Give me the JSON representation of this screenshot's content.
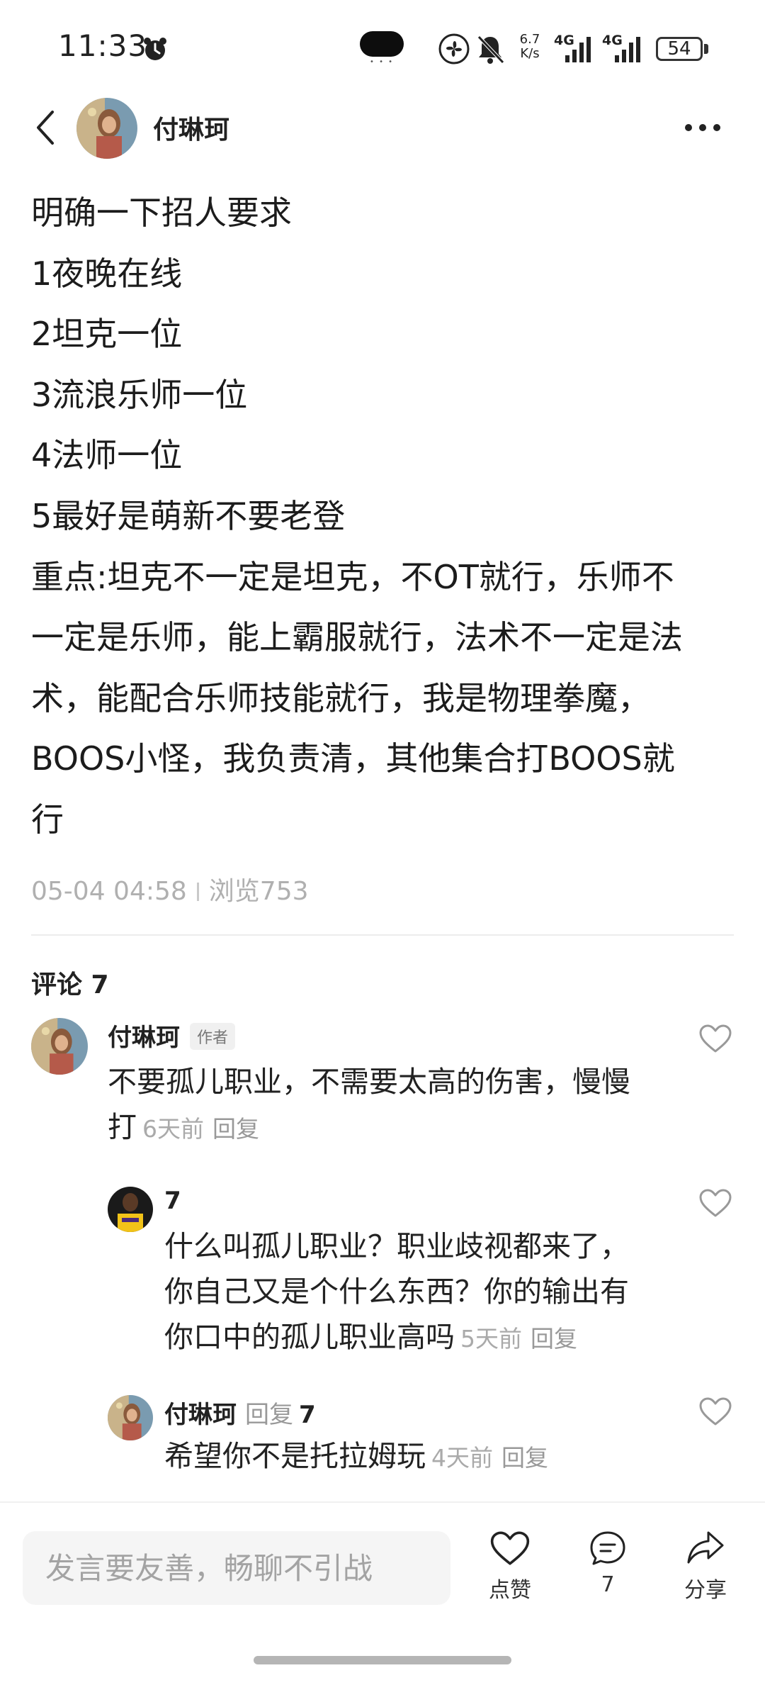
{
  "status_bar": {
    "time": "11:33",
    "net_speed_value": "6.7",
    "net_speed_unit": "K/s",
    "signal_1": "4G",
    "signal_2": "4G",
    "battery": "54"
  },
  "header": {
    "author_name": "付琳珂"
  },
  "post": {
    "lines": [
      "明确一下招人要求",
      "1夜晚在线",
      "2坦克一位",
      "3流浪乐师一位",
      "4法师一位",
      "5最好是萌新不要老登",
      "重点:坦克不一定是坦克，不OT就行，乐师不",
      "一定是乐师，能上霸服就行，法术不一定是法",
      "术，能配合乐师技能就行，我是物理拳魔，",
      "BOOS小怪，我负责清，其他集合打BOOS就",
      "行"
    ],
    "date": "05-04 04:58",
    "views": "浏览753"
  },
  "comments_section": {
    "title": "评论 7",
    "comments": [
      {
        "name": "付琳珂",
        "badge": "作者",
        "text_line1": "不要孤儿职业，不需要太高的伤害，慢慢",
        "text_line2": "打",
        "time": "6天前",
        "reply_label": "回复"
      },
      {
        "name": "7",
        "text_line1": "什么叫孤儿职业？职业歧视都来了，",
        "text_line2": "你自己又是个什么东西？你的输出有",
        "text_line3": "你口中的孤儿职业高吗",
        "time": "5天前",
        "reply_label": "回复"
      },
      {
        "name": "付琳珂",
        "reply_word": "回复",
        "reply_target": "7",
        "text_line1": "希望你不是托拉姆玩",
        "time": "4天前",
        "reply_label": "回复"
      }
    ]
  },
  "bottom_bar": {
    "input_placeholder": "发言要友善，畅聊不引战",
    "like_label": "点赞",
    "comment_count": "7",
    "share_label": "分享"
  },
  "icons": {
    "back": "chevron-left-icon",
    "more": "more-dots-icon",
    "like": "heart-icon",
    "comment": "comment-bubble-icon",
    "share": "share-arrow-icon",
    "alarm": "alarm-clock-icon"
  },
  "colors": {
    "text_primary": "#1c1c1c",
    "text_muted": "#aaaaaa",
    "input_bg": "#f5f5f5"
  }
}
